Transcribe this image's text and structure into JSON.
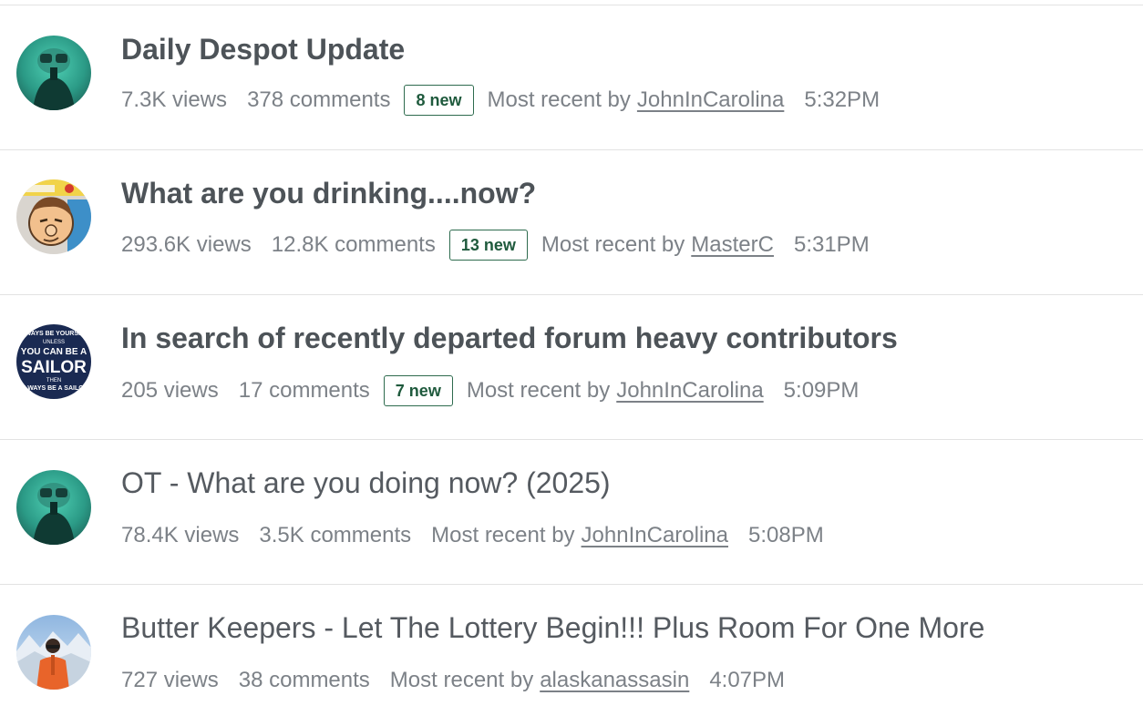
{
  "discussions": [
    {
      "title": "Daily Despot Update",
      "unread": true,
      "views": "7.3K views",
      "comments": "378 comments",
      "new_badge": "8 new",
      "recent_prefix": "Most recent by",
      "recent_user": "JohnInCarolina",
      "time": "5:32PM",
      "avatar": "avatar-scuba-diver-icon"
    },
    {
      "title": "What are you drinking....now?",
      "unread": true,
      "views": "293.6K views",
      "comments": "12.8K comments",
      "new_badge": "13 new",
      "recent_prefix": "Most recent by",
      "recent_user": "MasterC",
      "time": "5:31PM",
      "avatar": "avatar-cartoon-face-icon"
    },
    {
      "title": "In search of recently departed forum heavy contributors",
      "unread": true,
      "views": "205 views",
      "comments": "17 comments",
      "new_badge": "7 new",
      "recent_prefix": "Most recent by",
      "recent_user": "JohnInCarolina",
      "time": "5:09PM",
      "avatar": "avatar-sailor-sign-icon"
    },
    {
      "title": "OT - What are you doing now? (2025)",
      "unread": false,
      "views": "78.4K views",
      "comments": "3.5K comments",
      "new_badge": "",
      "recent_prefix": "Most recent by",
      "recent_user": "JohnInCarolina",
      "time": "5:08PM",
      "avatar": "avatar-scuba-diver-icon"
    },
    {
      "title": "Butter Keepers - Let The Lottery Begin!!! Plus Room For One More",
      "unread": false,
      "views": "727 views",
      "comments": "38 comments",
      "new_badge": "",
      "recent_prefix": "Most recent by",
      "recent_user": "alaskanassasin",
      "time": "4:07PM",
      "avatar": "avatar-skier-photo-icon"
    }
  ],
  "sailor_avatar_text": [
    "ALWAYS BE YOURSELF",
    "UNLESS",
    "YOU CAN BE A",
    "SAILOR",
    "THEN",
    "ALWAYS BE A SAILOR"
  ],
  "colors": {
    "badge_border": "#2e6b4e",
    "title": "#555a60",
    "meta": "#7c8187",
    "divider": "#e2e2e2"
  }
}
